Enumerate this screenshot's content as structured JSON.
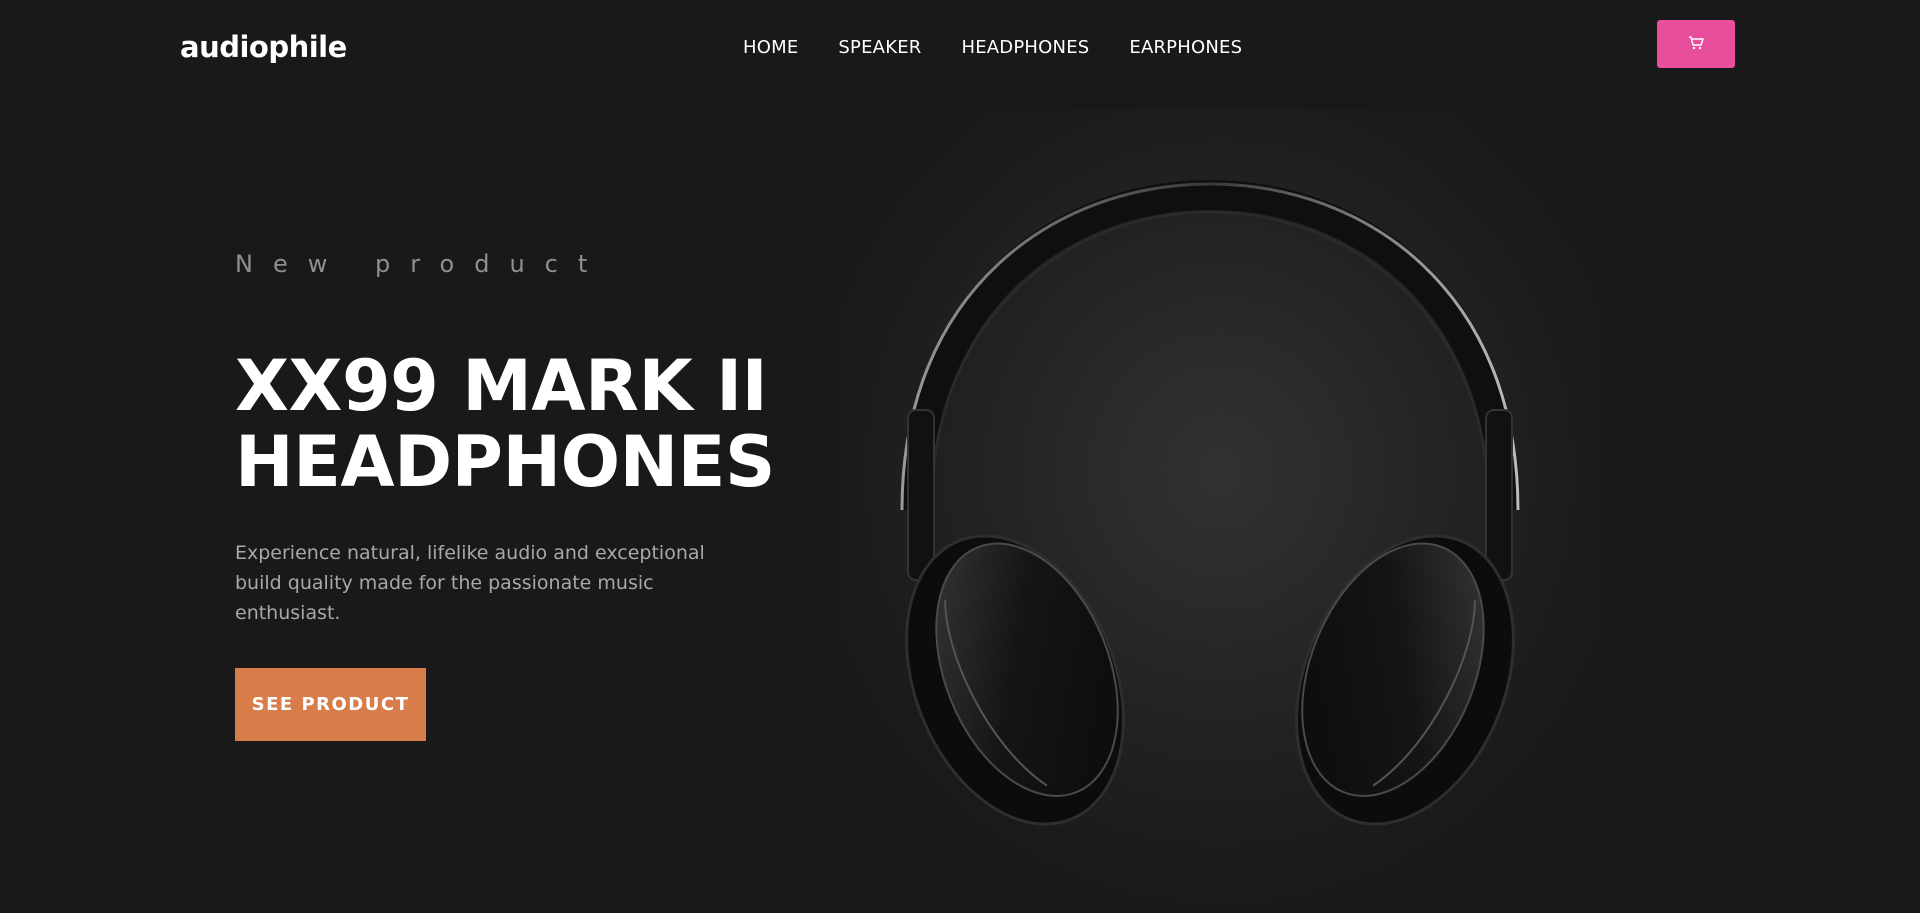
{
  "header": {
    "logo": "audiophile",
    "nav": [
      {
        "label": "HOME"
      },
      {
        "label": "SPEAKER"
      },
      {
        "label": "HEADPHONES"
      },
      {
        "label": "EARPHONES"
      }
    ],
    "cart_icon": "cart-icon"
  },
  "hero": {
    "eyebrow": "New product",
    "title_line1": "XX99 MARK II",
    "title_line2": "HEADPHONES",
    "description": "Experience natural, lifelike audio and exceptional build quality made for the passionate music enthusiast.",
    "cta_label": "SEE PRODUCT",
    "image_icon": "headphones-image"
  },
  "colors": {
    "background": "#191919",
    "accent_pink": "#e94e9c",
    "accent_orange": "#d87d4a"
  }
}
